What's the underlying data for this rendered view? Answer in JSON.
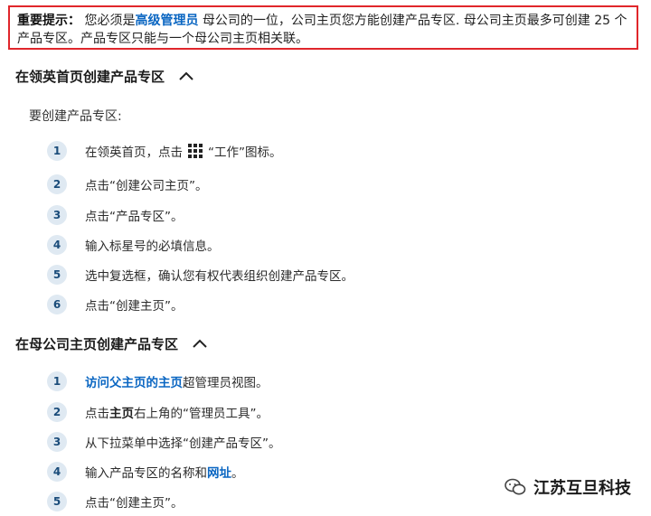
{
  "note": {
    "label": "重要提示：",
    "pre": " 您必须是",
    "link": "高级管理员",
    "post": " 母公司的一位，公司主页您方能创建产品专区. 母公司主页最多可创建 25 个产品专区。产品专区只能与一个母公司主页相关联。"
  },
  "section1": {
    "title": "在领英首页创建产品专区",
    "intro": "要创建产品专区:",
    "steps": [
      {
        "num": "1",
        "a": "在领英首页，点击",
        "b": "“工作”图标。"
      },
      {
        "num": "2",
        "text": "点击“创建公司主页”。"
      },
      {
        "num": "3",
        "text": "点击“产品专区”。"
      },
      {
        "num": "4",
        "text": "输入标星号的必填信息。"
      },
      {
        "num": "5",
        "text": "选中复选框，确认您有权代表组织创建产品专区。"
      },
      {
        "num": "6",
        "text": "点击“创建主页”。"
      }
    ]
  },
  "section2": {
    "title": "在母公司主页创建产品专区",
    "steps": [
      {
        "num": "1",
        "link": "访问父主页的主页",
        "rest": " 超管理员视图。"
      },
      {
        "num": "2",
        "a": "点击",
        "strong": "主页",
        "b": " 右上角的“管理员工具”。"
      },
      {
        "num": "3",
        "text": "从下拉菜单中选择“创建产品专区”。"
      },
      {
        "num": "4",
        "a": "输入产品专区的名称和",
        "link": "网址",
        "b": "。"
      },
      {
        "num": "5",
        "text": "点击“创建主页”。"
      }
    ]
  },
  "watermark": {
    "text": "江苏互旦科技",
    "icon": "wechat-icon"
  }
}
